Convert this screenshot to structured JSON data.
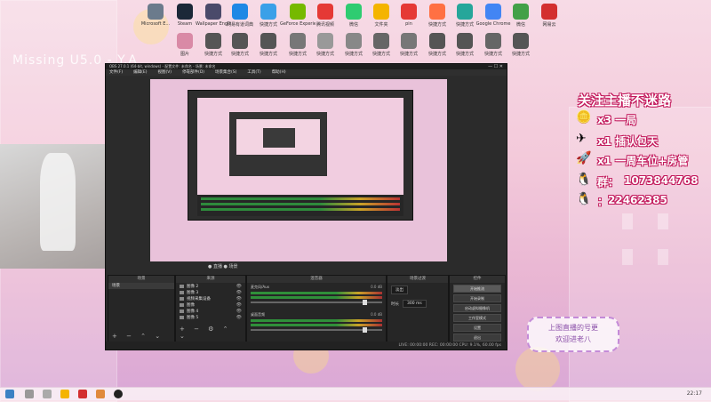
{
  "desktop": {
    "watermark": "Missing U5.0 - Y.A",
    "icons_row1": [
      {
        "label": "Microsoft E...",
        "color": "#6b7b8c"
      },
      {
        "label": "Steam",
        "color": "#1b2838"
      },
      {
        "label": "Wallpaper Engine",
        "color": "#4a4a6a"
      },
      {
        "label": "网易有道词典",
        "color": "#1e88e5"
      },
      {
        "label": "快捷方式",
        "color": "#3aa0e8"
      },
      {
        "label": "GeForce Experience",
        "color": "#76b900"
      },
      {
        "label": "腾讯视频",
        "color": "#e53935"
      },
      {
        "label": "微信",
        "color": "#2ecc71"
      },
      {
        "label": "文件夹",
        "color": "#f4b400"
      },
      {
        "label": "pin",
        "color": "#e53935"
      },
      {
        "label": "快捷方式",
        "color": "#ff7043"
      },
      {
        "label": "快捷方式",
        "color": "#26a69a"
      },
      {
        "label": "Google Chrome",
        "color": "#4285f4"
      },
      {
        "label": "微信",
        "color": "#43a047"
      },
      {
        "label": "网易云",
        "color": "#d32f2f"
      }
    ],
    "icons_row2": [
      {
        "label": "图片",
        "color": "#d98aa6"
      },
      {
        "label": "快捷方式",
        "color": "#555"
      },
      {
        "label": "快捷方式",
        "color": "#555"
      },
      {
        "label": "快捷方式",
        "color": "#555"
      },
      {
        "label": "快捷方式",
        "color": "#777"
      },
      {
        "label": "快捷方式",
        "color": "#999"
      },
      {
        "label": "快捷方式",
        "color": "#888"
      },
      {
        "label": "快捷方式",
        "color": "#666"
      },
      {
        "label": "快捷方式",
        "color": "#777"
      },
      {
        "label": "快捷方式",
        "color": "#555"
      },
      {
        "label": "快捷方式",
        "color": "#555"
      },
      {
        "label": "快捷方式",
        "color": "#666"
      },
      {
        "label": "快捷方式",
        "color": "#555"
      }
    ]
  },
  "obs": {
    "title": "OBS 27.0.1 (64-bit, windows) - 配置文件: 未命名 - 场景: 未命名",
    "menu": [
      "文件(F)",
      "编辑(E)",
      "视图(V)",
      "停靠部件(D)",
      "场景集合(S)",
      "工具(T)",
      "帮助(H)"
    ],
    "window_buttons": "—  ☐  ✕",
    "docks": {
      "scenes": {
        "title": "场景",
        "items": [
          "场景"
        ]
      },
      "sources": {
        "title": "来源",
        "items": [
          "图像 2",
          "图像 3",
          "视频采集设备",
          "图像",
          "图像 4",
          "图像 5"
        ]
      },
      "mixer": {
        "title": "混音器",
        "tracks": [
          {
            "name": "麦克风/Aux",
            "db": "0.0 dB"
          },
          {
            "name": "桌面音频",
            "db": "0.0 dB"
          }
        ]
      },
      "transitions": {
        "title": "场景过渡",
        "type": "淡出",
        "duration_label": "时长",
        "duration": "300 ms"
      },
      "controls": {
        "title": "控件",
        "buttons": [
          "开始推流",
          "开始录制",
          "启动虚拟摄像机",
          "工作室模式",
          "设置",
          "退出"
        ]
      }
    },
    "scene_tabs": "● 直播  ● 场景",
    "status": "LIVE: 00:00:00   REC: 00:00:00   CPU: 9.1%, 60.00 fps"
  },
  "overlay": {
    "headline": "关注主播不迷路",
    "perks": [
      {
        "icon": "gold-bar-icon",
        "text": "x3 一局"
      },
      {
        "icon": "plane-icon",
        "text": "x1 插认包天"
      },
      {
        "icon": "rocket-icon",
        "text": "x1 一周车位+房管"
      }
    ],
    "group_label": "群：",
    "group_number": "1073844768",
    "qq_label": "：",
    "qq_number": "22462385",
    "bubble_lines": [
      "上图直播的号更",
      "欢迎进老八"
    ]
  },
  "taskbar": {
    "clock": "22:17"
  }
}
